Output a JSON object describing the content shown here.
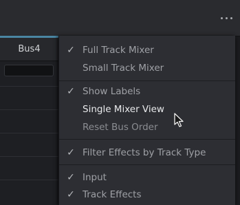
{
  "topbar": {
    "more_icon": "ellipsis-horizontal-icon"
  },
  "left_panel": {
    "bus_label": "Bus4"
  },
  "menu": {
    "items": [
      {
        "label": "Full Track Mixer",
        "checked": true
      },
      {
        "label": "Small Track Mixer",
        "checked": false
      },
      {
        "label": "Show Labels",
        "checked": true
      },
      {
        "label": "Single Mixer View",
        "checked": false,
        "hovered": true
      },
      {
        "label": "Reset Bus Order",
        "checked": false,
        "disabled": true
      },
      {
        "label": "Filter Effects by Track Type",
        "checked": true
      },
      {
        "label": "Input",
        "checked": true
      },
      {
        "label": "Track Effects",
        "checked": true
      }
    ],
    "check_glyph": "✓"
  },
  "cursor": {
    "icon": "arrow-pointer-icon"
  }
}
